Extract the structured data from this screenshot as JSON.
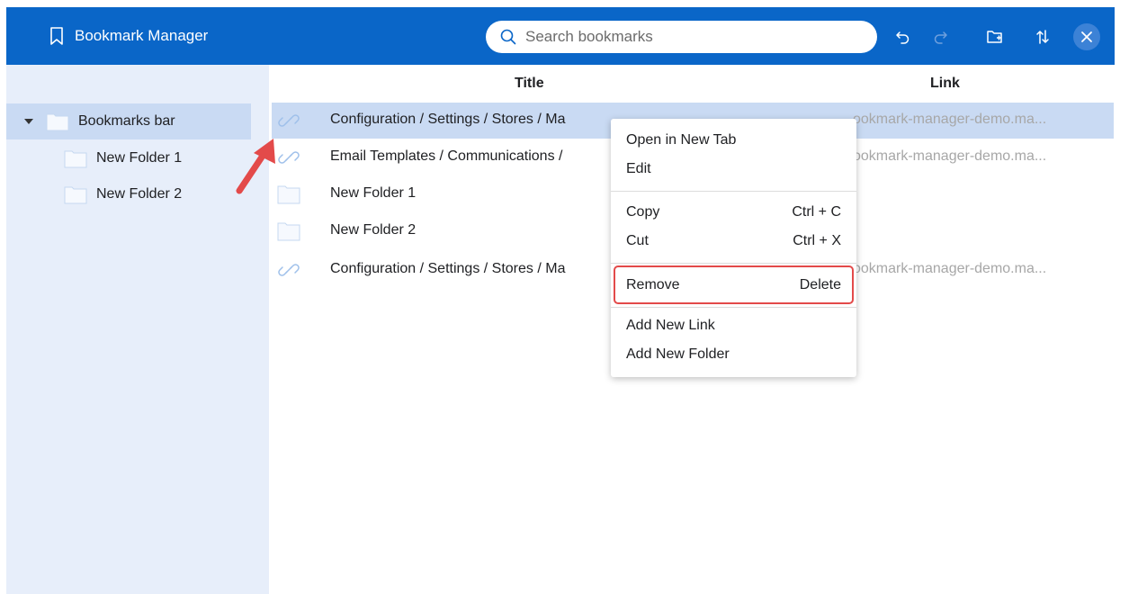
{
  "header": {
    "app_title": "Bookmark Manager",
    "search_placeholder": "Search bookmarks"
  },
  "sidebar": {
    "items": [
      {
        "label": "Bookmarks bar",
        "expanded": true,
        "selected": true
      },
      {
        "label": "New Folder 1"
      },
      {
        "label": "New Folder 2"
      }
    ]
  },
  "list": {
    "columns": {
      "title": "Title",
      "link": "Link"
    },
    "rows": [
      {
        "type": "link",
        "title": "Configuration / Settings / Stores / Ma",
        "link": "ookmark-manager-demo.ma...",
        "selected": true
      },
      {
        "type": "link",
        "title": "Email Templates / Communications /",
        "link": "ookmark-manager-demo.ma..."
      },
      {
        "type": "folder",
        "title": "New Folder 1",
        "link": ""
      },
      {
        "type": "folder",
        "title": "New Folder 2",
        "link": ""
      },
      {
        "type": "link",
        "title": "Configuration / Settings / Stores / Ma",
        "link": "ookmark-manager-demo.ma..."
      }
    ]
  },
  "context_menu": {
    "open_new_tab": "Open in New Tab",
    "edit": "Edit",
    "copy": "Copy",
    "copy_shortcut": "Ctrl + C",
    "cut": "Cut",
    "cut_shortcut": "Ctrl + X",
    "remove": "Remove",
    "remove_shortcut": "Delete",
    "add_link": "Add New Link",
    "add_folder": "Add New Folder"
  },
  "colors": {
    "header_bg": "#0a66c8",
    "sidebar_bg": "#e7eefa",
    "selected_bg": "#c9daf3",
    "highlight_red": "#e34a4a"
  },
  "icons": [
    "bookmark-icon",
    "search-icon",
    "undo-icon",
    "redo-icon",
    "new-folder-icon",
    "sort-icon",
    "close-icon",
    "folder-icon",
    "link-icon"
  ]
}
